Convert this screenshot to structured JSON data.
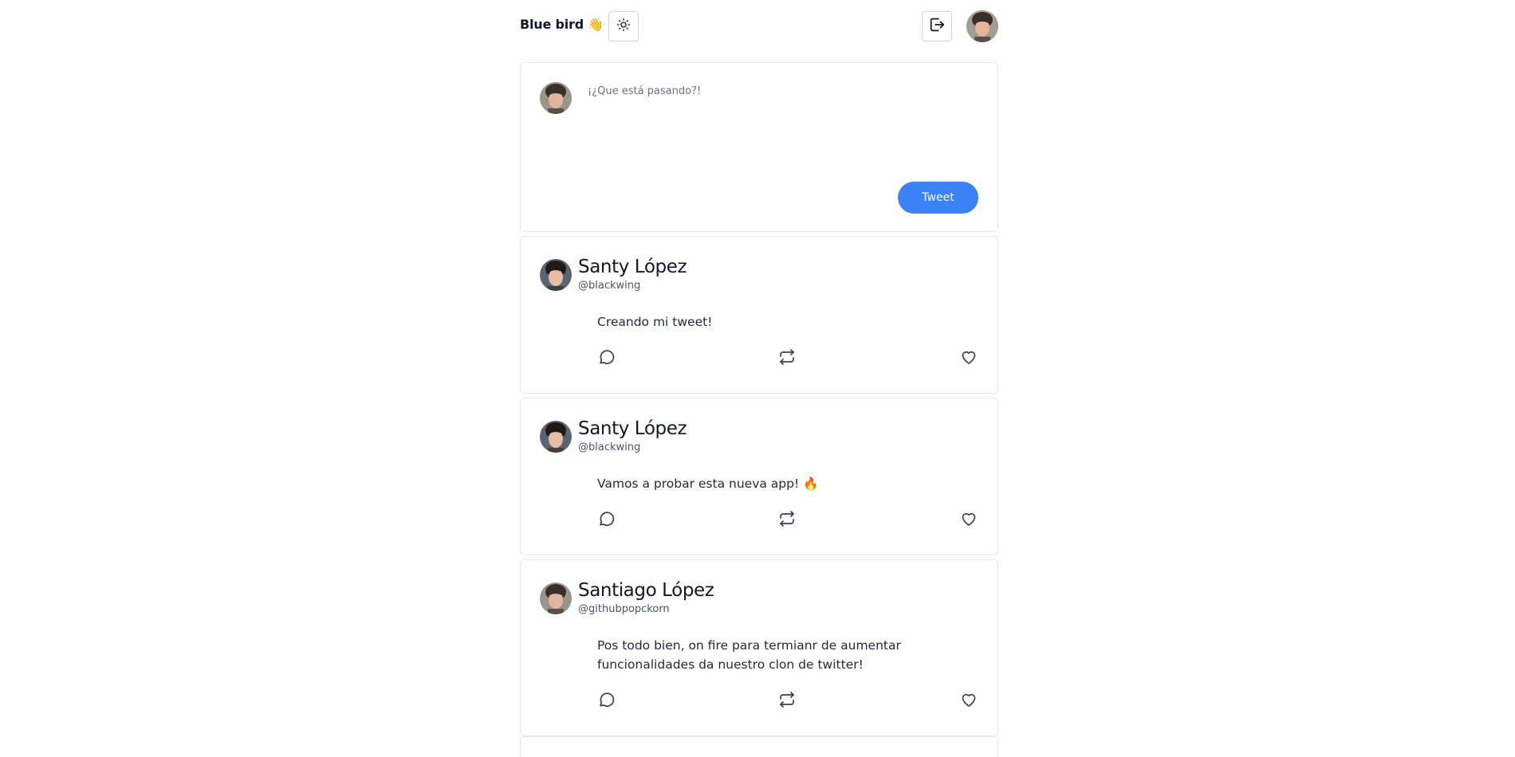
{
  "header": {
    "brand": "Blue bird 👋",
    "theme_icon": "sun-icon",
    "logout_icon": "logout-icon"
  },
  "compose": {
    "placeholder": "¡¿Que está pasando?!",
    "tweet_label": "Tweet"
  },
  "colors": {
    "accent": "#3b82f6",
    "border": "#e5e7eb"
  },
  "tweets": [
    {
      "name": "Santy López",
      "handle": "@blackwing",
      "content": "Creando mi tweet!"
    },
    {
      "name": "Santy López",
      "handle": "@blackwing",
      "content": "Vamos a probar esta nueva app! 🔥"
    },
    {
      "name": "Santiago López",
      "handle": "@githubpopckorn",
      "content": "Pos todo bien, on fire para termianr de aumentar funcionalidades da nuestro clon de twitter!"
    }
  ],
  "actions": {
    "comment_icon": "comment-icon",
    "retweet_icon": "retweet-icon",
    "like_icon": "heart-icon"
  }
}
